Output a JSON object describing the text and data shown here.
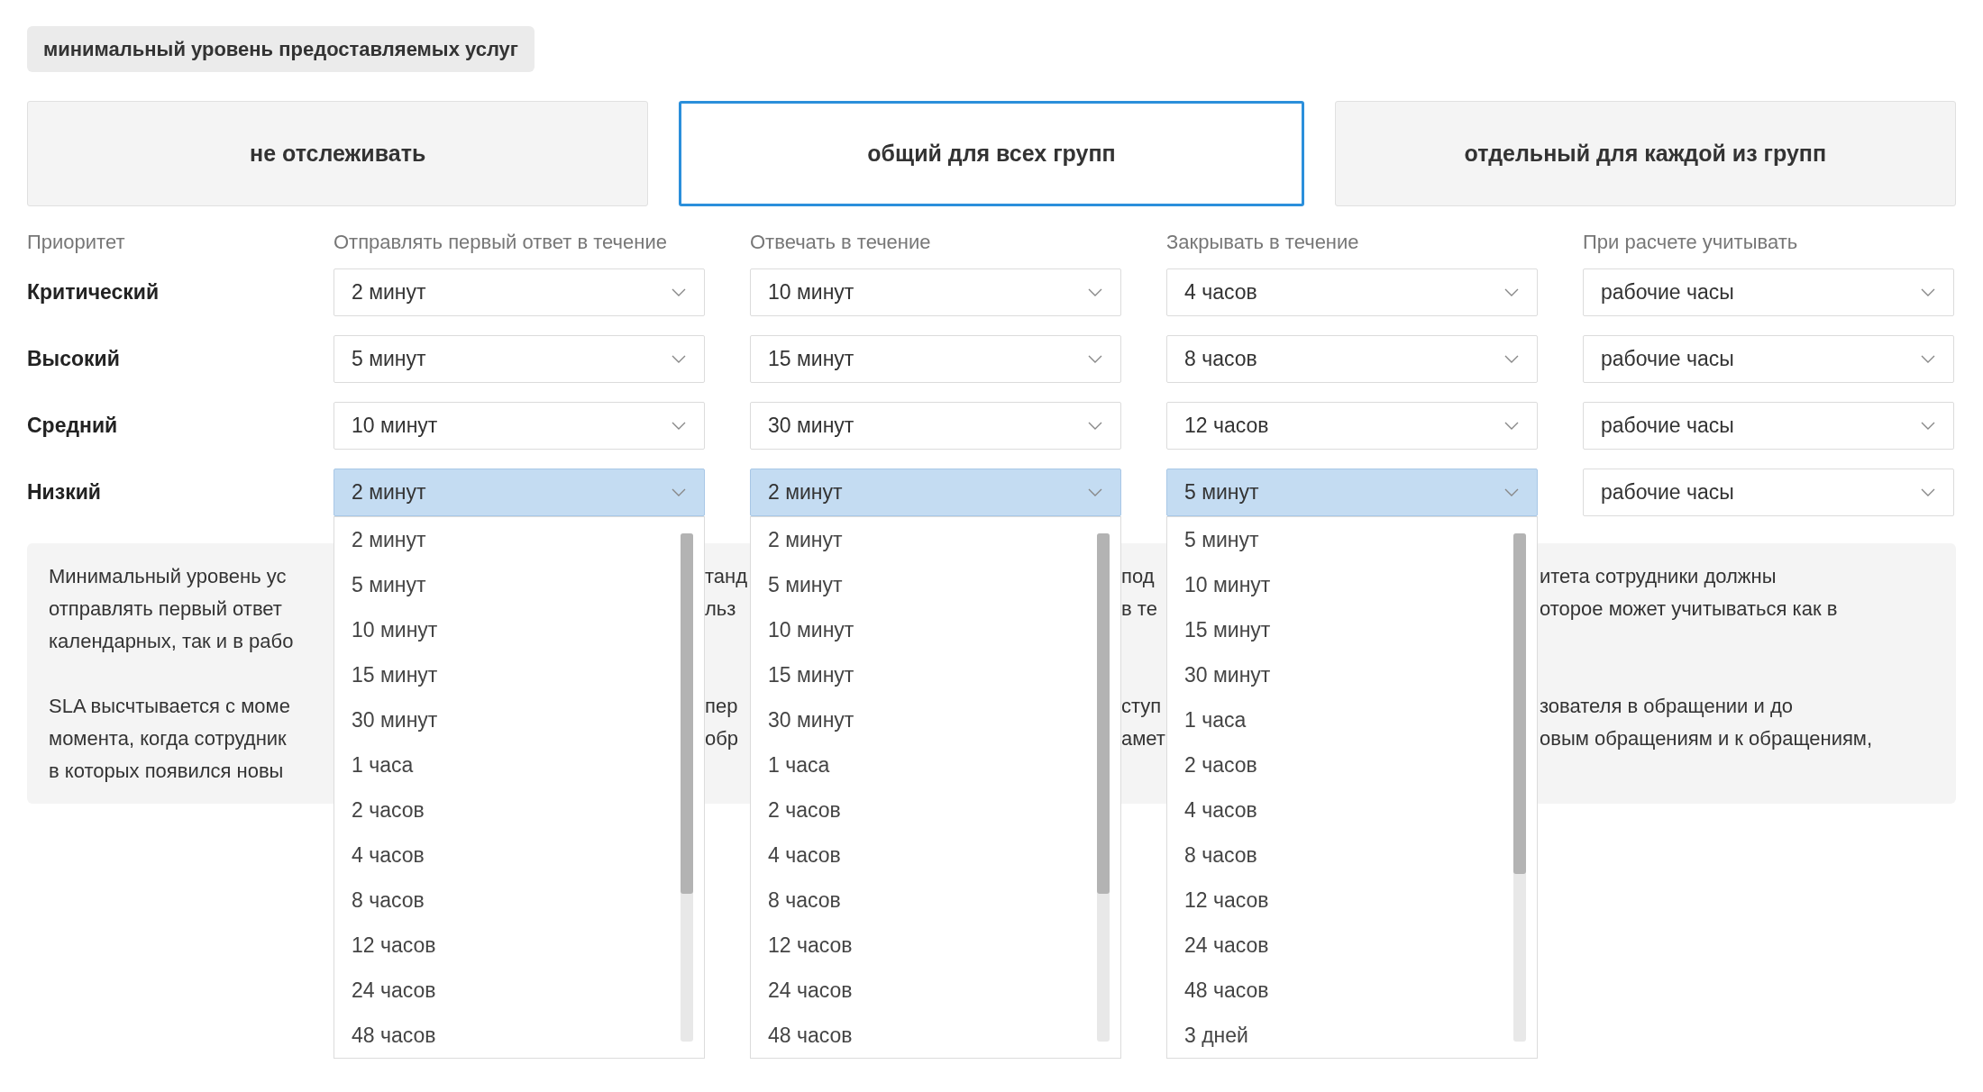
{
  "section_tag": "минимальный уровень предоставляемых услуг",
  "modes": [
    {
      "label": "не отслеживать",
      "selected": false
    },
    {
      "label": "общий для всех групп",
      "selected": true
    },
    {
      "label": "отдельный для каждой из групп",
      "selected": false
    }
  ],
  "columns": [
    "Приоритет",
    "Отправлять первый ответ в течение",
    "Отвечать в течение",
    "Закрывать в течение",
    "При расчете учитывать"
  ],
  "rows": [
    {
      "priority": "Критический",
      "cells": [
        {
          "value": "2 минут",
          "open": false
        },
        {
          "value": "10 минут",
          "open": false
        },
        {
          "value": "4 часов",
          "open": false
        },
        {
          "value": "рабочие часы",
          "open": false
        }
      ]
    },
    {
      "priority": "Высокий",
      "cells": [
        {
          "value": "5 минут",
          "open": false
        },
        {
          "value": "15 минут",
          "open": false
        },
        {
          "value": "8 часов",
          "open": false
        },
        {
          "value": "рабочие часы",
          "open": false
        }
      ]
    },
    {
      "priority": "Средний",
      "cells": [
        {
          "value": "10 минут",
          "open": false
        },
        {
          "value": "30 минут",
          "open": false
        },
        {
          "value": "12 часов",
          "open": false
        },
        {
          "value": "рабочие часы",
          "open": false
        }
      ]
    },
    {
      "priority": "Низкий",
      "cells": [
        {
          "value": "2 минут",
          "open": true,
          "options": [
            "2 минут",
            "5 минут",
            "10 минут",
            "15 минут",
            "30 минут",
            "1 часа",
            "2 часов",
            "4 часов",
            "8 часов",
            "12 часов",
            "24 часов",
            "48 часов"
          ]
        },
        {
          "value": "2 минут",
          "open": true,
          "options": [
            "2 минут",
            "5 минут",
            "10 минут",
            "15 минут",
            "30 минут",
            "1 часа",
            "2 часов",
            "4 часов",
            "8 часов",
            "12 часов",
            "24 часов",
            "48 часов"
          ]
        },
        {
          "value": "5 минут",
          "open": true,
          "options": [
            "5 минут",
            "10 минут",
            "15 минут",
            "30 минут",
            "1 часа",
            "2 часов",
            "4 часов",
            "8 часов",
            "12 часов",
            "24 часов",
            "48 часов",
            "3 дней"
          ]
        },
        {
          "value": "рабочие часы",
          "open": false
        }
      ]
    }
  ],
  "info_panel": {
    "strips": [
      [
        [
          "Минимальный уровень ус",
          "отправлять первый ответ",
          "календарных, так и в рабо"
        ],
        [
          "SLA высчтывается с моме",
          "момента, когда сотрудник",
          "в которых появился новы"
        ]
      ],
      [
        [
          "танд",
          "льз"
        ],
        [
          "пер",
          "обр"
        ]
      ],
      [
        [
          "под",
          "в те"
        ],
        [
          "ступ",
          "амет"
        ]
      ],
      [
        [
          "итета сотрудники должны",
          "оторое может учитываться как в"
        ],
        [
          "зователя в обращении и до",
          "овым обращениям и к обращениям,"
        ]
      ]
    ]
  }
}
